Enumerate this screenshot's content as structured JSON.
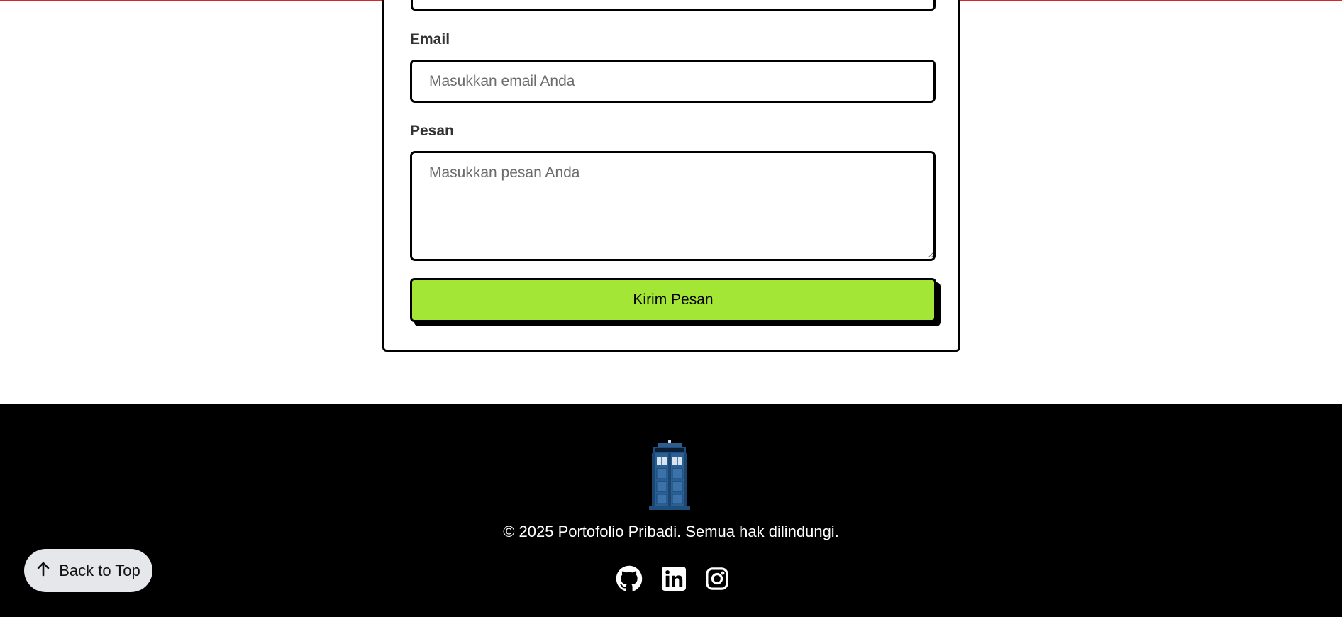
{
  "form": {
    "email_label": "Email",
    "email_placeholder": "Masukkan email Anda",
    "message_label": "Pesan",
    "message_placeholder": "Masukkan pesan Anda",
    "submit_label": "Kirim Pesan"
  },
  "footer": {
    "logo_icon": "police-box-icon",
    "copyright": "© 2025 Portofolio Pribadi. Semua hak dilindungi.",
    "social_icons": [
      "github-icon",
      "linkedin-icon",
      "instagram-icon"
    ],
    "back_to_top_label": "Back to Top"
  },
  "colors": {
    "accent": "#a3e635",
    "footer_bg": "#000000",
    "pill_bg": "#e5e7eb",
    "top_line": "#d62828"
  }
}
